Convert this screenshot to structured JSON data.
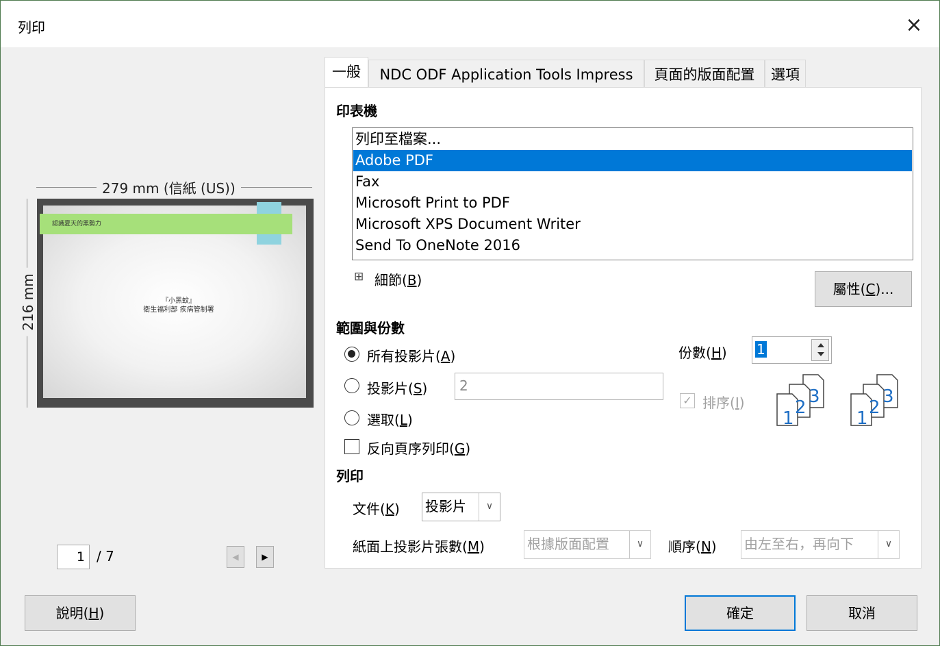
{
  "window": {
    "title": "列印",
    "close_glyph": "×"
  },
  "preview": {
    "width_label": "279 mm (信紙 (US))",
    "height_label": "216 mm",
    "slide_title": "認識夏天的黑勢力",
    "slide_body": "『小黑蚊』\n衛生福利部 疾病管制署",
    "page_current": "1",
    "page_total": "/ 7",
    "prev_glyph": "◀",
    "next_glyph": "▶"
  },
  "tabs": [
    {
      "label": "一般"
    },
    {
      "label": "NDC ODF Application Tools Impress"
    },
    {
      "label": "頁面的版面配置"
    },
    {
      "label": "選項"
    }
  ],
  "printer": {
    "section_label": "印表機",
    "list": [
      "列印至檔案...",
      "Adobe PDF",
      "Fax",
      "Microsoft Print to PDF",
      "Microsoft XPS Document Writer",
      "Send To OneNote 2016"
    ],
    "selected": "Adobe PDF",
    "details_expander": "⊞",
    "details_label": "細節(",
    "details_key": "B",
    "properties_label": "屬性(",
    "properties_key": "C",
    "properties_suffix": ")..."
  },
  "range": {
    "section_label": "範圍與份數",
    "all_slides": {
      "label": "所有投影片(",
      "key": "A"
    },
    "slides": {
      "label": "投影片(",
      "key": "S",
      "value": "2"
    },
    "selection": {
      "label": "選取(",
      "key": "L"
    },
    "reverse": {
      "label": "反向頁序列印(",
      "key": "G"
    },
    "copies_label": "份數(",
    "copies_key": "H",
    "copies_value": "1",
    "collate_label": "排序(",
    "collate_key": "I",
    "collate_glyph": "✓"
  },
  "print": {
    "section_label": "列印",
    "document_label": "文件(",
    "document_key": "K",
    "document_value": "投影片",
    "per_page_label": "紙面上投影片張數(",
    "per_page_key": "M",
    "per_page_value": "根據版面配置",
    "order_label": "順序(",
    "order_key": "N",
    "order_value": "由左至右，再向下"
  },
  "buttons": {
    "help_label": "說明(",
    "help_key": "H",
    "ok_label": "確定",
    "cancel_label": "取消"
  },
  "collate_icon_digits": [
    "1",
    "2",
    "3"
  ],
  "colors": {
    "accent": "#0078d7",
    "slide_banner": "#a6e07a",
    "slide_tab": "#8fd3df"
  }
}
